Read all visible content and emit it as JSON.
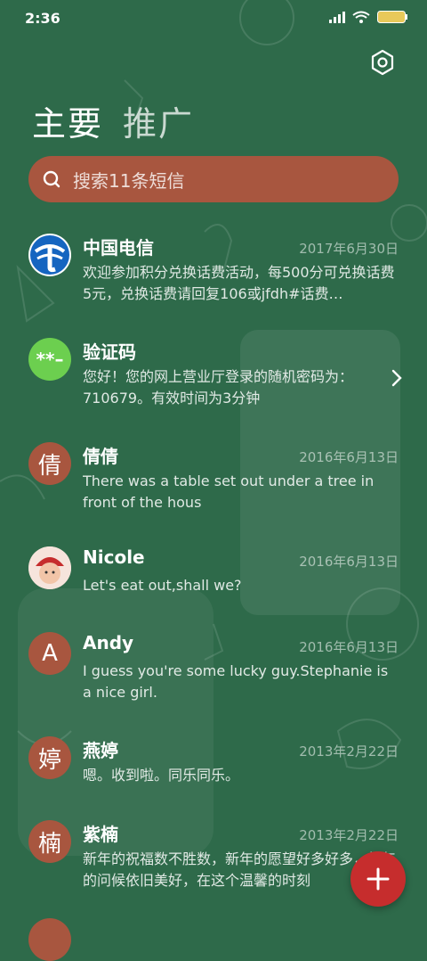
{
  "status_bar": {
    "time": "2:36",
    "battery_icon": "battery-icon",
    "wifi_icon": "wifi-icon",
    "signal_icon": "signal-icon"
  },
  "tabs": [
    {
      "label": "主要",
      "active": true
    },
    {
      "label": "推广",
      "active": false
    }
  ],
  "search": {
    "placeholder": "搜索11条短信"
  },
  "colors": {
    "background": "#2e6a4a",
    "accent": "#a8563f",
    "fab": "#c62d2d",
    "avatar_green": "#6ccf4f",
    "telecom_blue": "#1565c0"
  },
  "messages": [
    {
      "name": "中国电信",
      "date": "2017年6月30日",
      "preview": "欢迎参加积分兑换话费活动，每500分可兑换话费5元，兑换话费请回复106或jfdh#话费…",
      "avatar_text": "",
      "avatar_icon": "telecom-logo"
    },
    {
      "name": "验证码",
      "date": "",
      "preview": "您好！您的网上营业厅登录的随机密码为：710679。有效时间为3分钟",
      "avatar_text": "**–",
      "avatar_icon": ""
    },
    {
      "name": "倩倩",
      "date": "2016年6月13日",
      "preview": "There was a table set out under a tree in front of the hous",
      "avatar_text": "倩",
      "avatar_icon": ""
    },
    {
      "name": "Nicole",
      "date": "2016年6月13日",
      "preview": "Let's eat out,shall we?",
      "avatar_text": "",
      "avatar_icon": "photo-avatar"
    },
    {
      "name": "Andy",
      "date": "2016年6月13日",
      "preview": "I guess you're some lucky guy.Stephanie is a nice girl.",
      "avatar_text": "A",
      "avatar_icon": ""
    },
    {
      "name": "燕婷",
      "date": "2013年2月22日",
      "preview": "嗯。收到啦。同乐同乐。",
      "avatar_text": "婷",
      "avatar_icon": ""
    },
    {
      "name": "紫楠",
      "date": "2013年2月22日",
      "preview": "新年的祝福数不胜数，新年的愿望好多好多，新年的问候依旧美好，在这个温馨的时刻",
      "avatar_text": "楠",
      "avatar_icon": ""
    }
  ],
  "fab": {
    "label": "+"
  }
}
